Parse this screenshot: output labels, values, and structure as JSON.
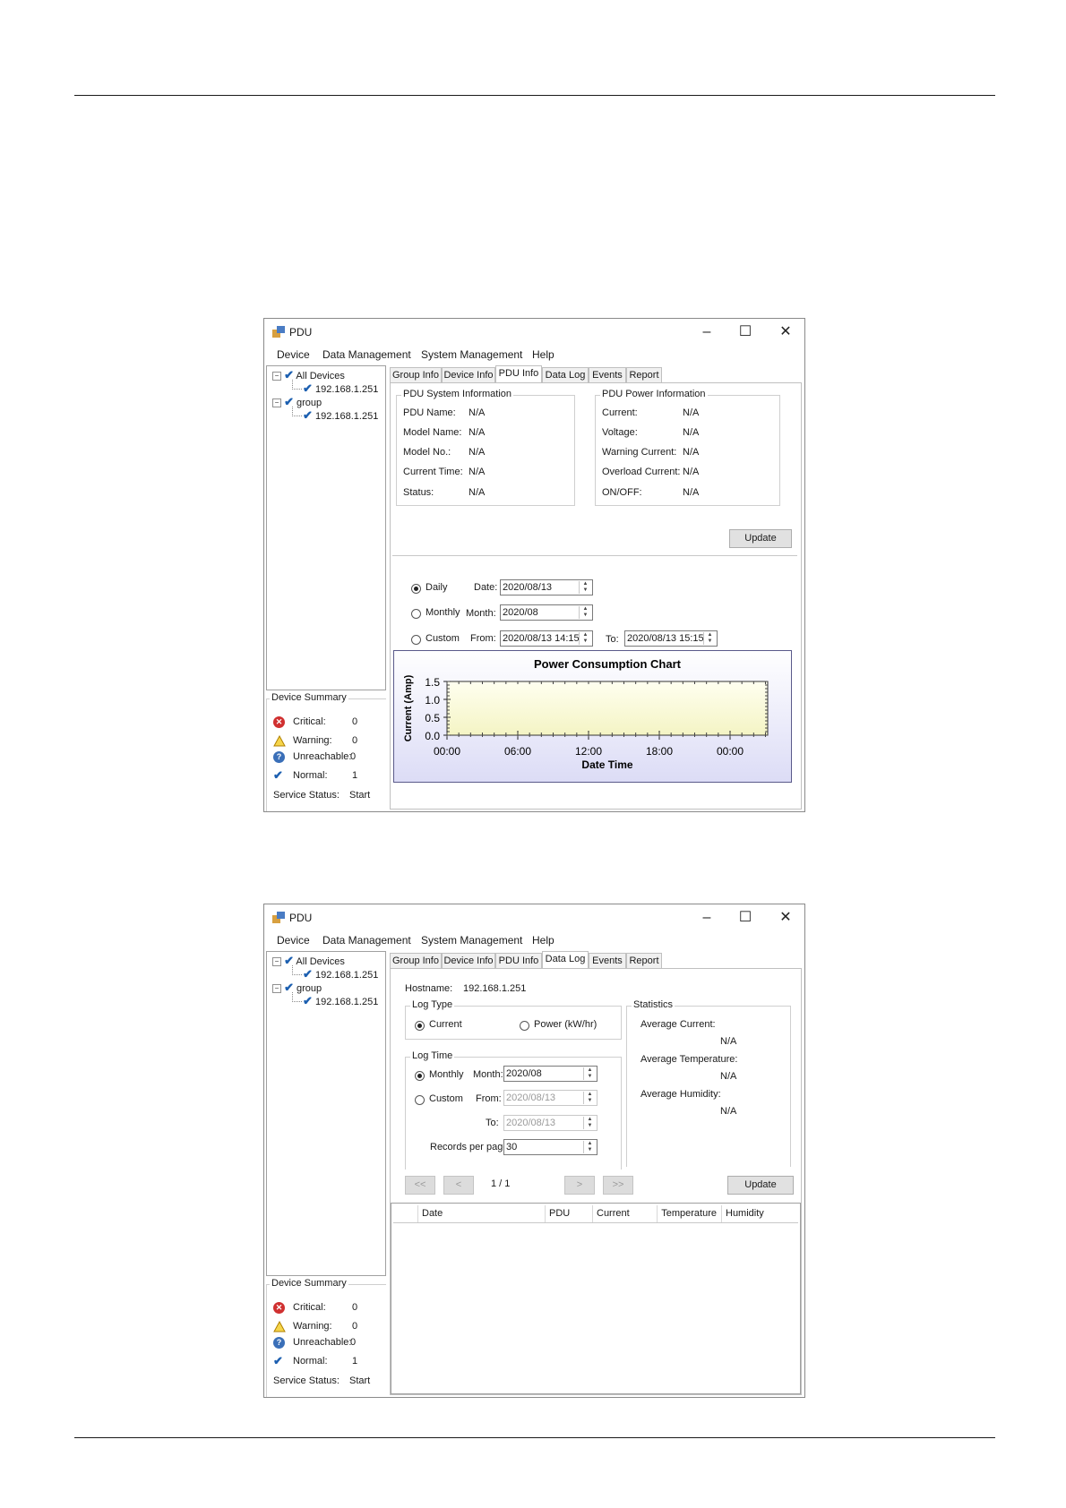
{
  "window_title": "PDU",
  "menu": [
    "Device",
    "Data Management",
    "System Management",
    "Help"
  ],
  "tabs": [
    "Group Info",
    "Device Info",
    "PDU Info",
    "Data Log",
    "Events",
    "Report"
  ],
  "tree": {
    "all_devices": "All Devices",
    "group": "group",
    "device_ip": "192.168.1.251"
  },
  "summary": {
    "title": "Device Summary",
    "critical_label": "Critical:",
    "critical_value": "0",
    "warning_label": "Warning:",
    "warning_value": "0",
    "unreachable_label": "Unreachable:",
    "unreachable_value": "0",
    "normal_label": "Normal:",
    "normal_value": "1",
    "service_label": "Service Status:",
    "service_value": "Start"
  },
  "pdu_info": {
    "system_title": "PDU System Information",
    "system_rows": [
      {
        "label": "PDU Name:",
        "value": "N/A"
      },
      {
        "label": "Model Name:",
        "value": "N/A"
      },
      {
        "label": "Model No.:",
        "value": "N/A"
      },
      {
        "label": "Current Time:",
        "value": "N/A"
      },
      {
        "label": "Status:",
        "value": "N/A"
      }
    ],
    "power_title": "PDU Power Information",
    "power_rows": [
      {
        "label": "Current:",
        "value": "N/A"
      },
      {
        "label": "Voltage:",
        "value": "N/A"
      },
      {
        "label": "Warning Current:",
        "value": "N/A"
      },
      {
        "label": "Overload Current:",
        "value": "N/A"
      },
      {
        "label": "ON/OFF:",
        "value": "N/A"
      }
    ],
    "update": "Update",
    "daily": "Daily",
    "date_label": "Date:",
    "date_value": "2020/08/13",
    "monthly": "Monthly",
    "month_label": "Month:",
    "month_value": "2020/08",
    "custom": "Custom",
    "from_label": "From:",
    "from_value": "2020/08/13 14:15",
    "to_label": "To:",
    "to_value": "2020/08/13 15:15"
  },
  "chart_data": {
    "type": "area",
    "title": "Power Consumption Chart",
    "xlabel": "Date Time",
    "ylabel": "Current (Amp)",
    "x_ticks": [
      "00:00",
      "06:00",
      "12:00",
      "18:00",
      "00:00"
    ],
    "y_ticks": [
      "0.0",
      "0.5",
      "1.0",
      "1.5"
    ],
    "ylim": [
      0,
      1.5
    ],
    "series": [],
    "colors": {
      "plot_top": "#fffff0",
      "plot_bottom": "#f4f4c4",
      "frame": "#5a5a8a"
    }
  },
  "data_log": {
    "hostname_label": "Hostname:",
    "hostname_value": "192.168.1.251",
    "log_type_title": "Log Type",
    "current": "Current",
    "power": "Power (kW/hr)",
    "log_time_title": "Log Time",
    "monthly": "Monthly",
    "month_label": "Month:",
    "month_value": "2020/08",
    "custom": "Custom",
    "from_label": "From:",
    "from_value": "2020/08/13",
    "to_label": "To:",
    "to_value": "2020/08/13",
    "records_label": "Records per page:",
    "records_value": "30",
    "statistics_title": "Statistics",
    "avg_current_label": "Average Current:",
    "avg_current_value": "N/A",
    "avg_temp_label": "Average Temperature:",
    "avg_temp_value": "N/A",
    "avg_hum_label": "Average Humidity:",
    "avg_hum_value": "N/A",
    "first": "<<",
    "prev": "<",
    "page": "1 / 1",
    "next": ">",
    "last": ">>",
    "update": "Update",
    "columns": [
      "Date",
      "PDU",
      "Current",
      "Temperature",
      "Humidity"
    ]
  }
}
